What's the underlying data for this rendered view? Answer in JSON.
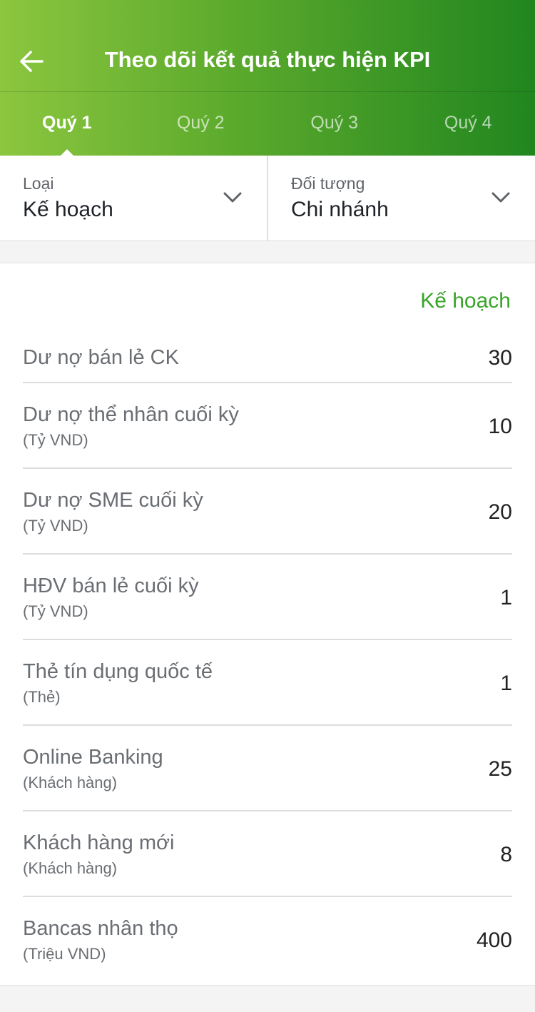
{
  "header": {
    "title": "Theo dõi kết quả thực hiện KPI",
    "back_icon": "arrow-left-icon"
  },
  "tabs": [
    {
      "label": "Quý 1",
      "active": true
    },
    {
      "label": "Quý 2",
      "active": false
    },
    {
      "label": "Quý 3",
      "active": false
    },
    {
      "label": "Quý 4",
      "active": false
    }
  ],
  "filters": {
    "type": {
      "label": "Loại",
      "value": "Kế hoạch"
    },
    "target": {
      "label": "Đối tượng",
      "value": "Chi nhánh"
    }
  },
  "table": {
    "column_header": "Kế hoạch",
    "rows": [
      {
        "name": "Dư nợ bán lẻ CK",
        "unit": "",
        "value": "30"
      },
      {
        "name": "Dư nợ thể nhân cuối kỳ",
        "unit": "(Tỷ VND)",
        "value": "10"
      },
      {
        "name": "Dư nợ SME cuối kỳ",
        "unit": "(Tỷ VND)",
        "value": "20"
      },
      {
        "name": "HĐV bán lẻ cuối kỳ",
        "unit": "(Tỷ VND)",
        "value": "1"
      },
      {
        "name": "Thẻ tín dụng quốc tế",
        "unit": "(Thẻ)",
        "value": "1"
      },
      {
        "name": "Online Banking",
        "unit": "(Khách hàng)",
        "value": "25"
      },
      {
        "name": "Khách hàng mới",
        "unit": "(Khách hàng)",
        "value": "8"
      },
      {
        "name": "Bancas nhân thọ",
        "unit": "(Triệu VND)",
        "value": "400"
      }
    ]
  },
  "colors": {
    "accent_green": "#38a52a",
    "header_gradient_start": "#8cc63f",
    "header_gradient_end": "#21861f"
  }
}
